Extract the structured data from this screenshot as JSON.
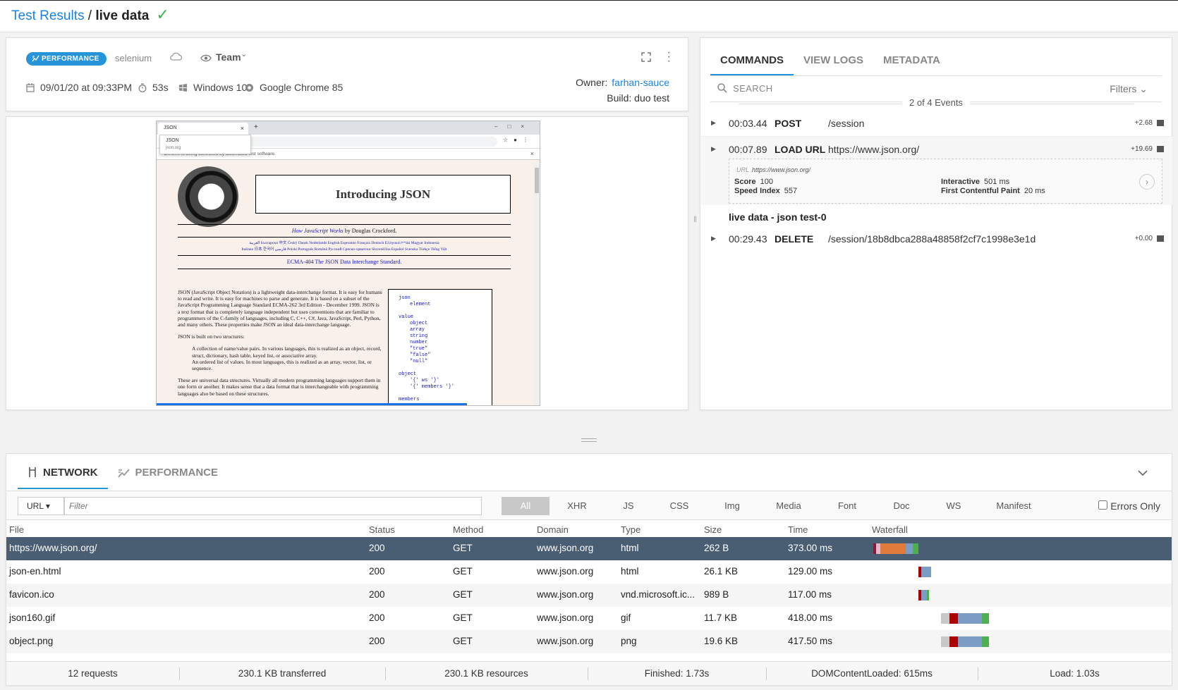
{
  "breadcrumb": {
    "root": "Test Results",
    "sep": " / ",
    "current": "live data"
  },
  "info": {
    "badge": "PERFORMANCE",
    "framework": "selenium",
    "visibility": "Team",
    "date": "09/01/20 at 09:33PM",
    "duration": "53s",
    "os": "Windows 10",
    "browser": "Google Chrome 85",
    "owner_label": "Owner:",
    "owner": "farhan-sauce",
    "build": "Build: duo test"
  },
  "screenshot": {
    "tab_title": "JSON",
    "dropdown_title": "JSON",
    "dropdown_url": "json.org",
    "automation_notice": "Chrome is being controlled by automated test software.",
    "heading": "Introducing JSON",
    "byline_link": "How JavaScript Works",
    "byline_rest": " by Douglas Crockford.",
    "languages_1": "العربية Български 中文 Český Dansk Nederlands English Esperanto Français Deutsch Ελληνικά עברית Magyar Indonesia",
    "languages_2": "Italiano 日本 한국어 فارسی Polski Português Română Русский Српско-хрватски Slovenščina Español Svenska Türkçe Tiếng Việt",
    "ecma": "ECMA-404 The JSON Data Interchange Standard.",
    "p1": "JSON (JavaScript Object Notation) is a lightweight data-interchange format. It is easy for humans to read and write. It is easy for machines to parse and generate. It is based on a subset of the JavaScript Programming Language Standard ECMA-262 3rd Edition - December 1999. JSON is a text format that is completely language independent but uses conventions that are familiar to programmers of the C-family of languages, including C, C++, C#, Java, JavaScript, Perl, Python, and many others. These properties make JSON an ideal data-interchange language.",
    "p2": "JSON is built on two structures:",
    "li1": "A collection of name/value pairs. In various languages, this is realized as an object, record, struct, dictionary, hash table, keyed list, or associative array.",
    "li2": "An ordered list of values. In most languages, this is realized as an array, vector, list, or sequence.",
    "p3": "These are universal data structures. Virtually all modern programming languages support them in one form or another. It makes sense that a data format that is interchangeable with programming languages also be based on these structures.",
    "grammar": [
      "json",
      "element",
      "value",
      "object",
      "array",
      "string",
      "number",
      "\"true\"",
      "\"false\"",
      "\"null\"",
      "object",
      "'{' ws '}'",
      "'{' members '}'",
      "members"
    ]
  },
  "commands": {
    "tabs": [
      "COMMANDS",
      "VIEW LOGS",
      "METADATA"
    ],
    "search_placeholder": "SEARCH",
    "filters": "Filters",
    "event_count": "2 of 4 Events",
    "events": [
      {
        "time": "00:03.44",
        "verb": "POST",
        "path": "/session",
        "delta": "+2.68"
      },
      {
        "time": "00:07.89",
        "verb": "LOAD URL",
        "path": "https://www.json.org/",
        "delta": "+19.69"
      },
      {
        "time": "00:29.43",
        "verb": "DELETE",
        "path": "/session/18b8dbca288a48858f2cf7c1998e3e1d",
        "delta": "+0.00"
      }
    ],
    "detail": {
      "url_label": "URL",
      "url": "https://www.json.org/",
      "score_label": "Score",
      "score": "100",
      "speed_label": "Speed Index",
      "speed": "557",
      "interactive_label": "Interactive",
      "interactive": "501 ms",
      "fcp_label": "First Contentful Paint",
      "fcp": "20 ms"
    },
    "group_title": "live data - json test-0"
  },
  "network": {
    "tabs": [
      "NETWORK",
      "PERFORMANCE"
    ],
    "url_select": "URL",
    "filter_placeholder": "Filter",
    "types": [
      "All",
      "XHR",
      "JS",
      "CSS",
      "Img",
      "Media",
      "Font",
      "Doc",
      "WS",
      "Manifest"
    ],
    "errors_only": "Errors Only",
    "columns": [
      "File",
      "Status",
      "Method",
      "Domain",
      "Type",
      "Size",
      "Time",
      "Waterfall"
    ],
    "rows": [
      {
        "file": "https://www.json.org/",
        "status": "200",
        "method": "GET",
        "domain": "www.json.org",
        "type": "html",
        "size": "262 B",
        "time": "373.00 ms"
      },
      {
        "file": "json-en.html",
        "status": "200",
        "method": "GET",
        "domain": "www.json.org",
        "type": "html",
        "size": "26.1 KB",
        "time": "129.00 ms"
      },
      {
        "file": "favicon.ico",
        "status": "200",
        "method": "GET",
        "domain": "www.json.org",
        "type": "vnd.microsoft.ic...",
        "size": "989 B",
        "time": "117.00 ms"
      },
      {
        "file": "json160.gif",
        "status": "200",
        "method": "GET",
        "domain": "www.json.org",
        "type": "gif",
        "size": "11.7 KB",
        "time": "418.00 ms"
      },
      {
        "file": "object.png",
        "status": "200",
        "method": "GET",
        "domain": "www.json.org",
        "type": "png",
        "size": "19.6 KB",
        "time": "417.50 ms"
      }
    ],
    "footer": [
      "12 requests",
      "230.1 KB transferred",
      "230.1 KB resources",
      "Finished: 1.73s",
      "DOMContentLoaded: 615ms",
      "Load: 1.03s"
    ]
  },
  "colors": {
    "accent": "#2694d8",
    "link": "#1a82e2",
    "selected_row": "#4a5e73",
    "success": "#3cb44b"
  }
}
